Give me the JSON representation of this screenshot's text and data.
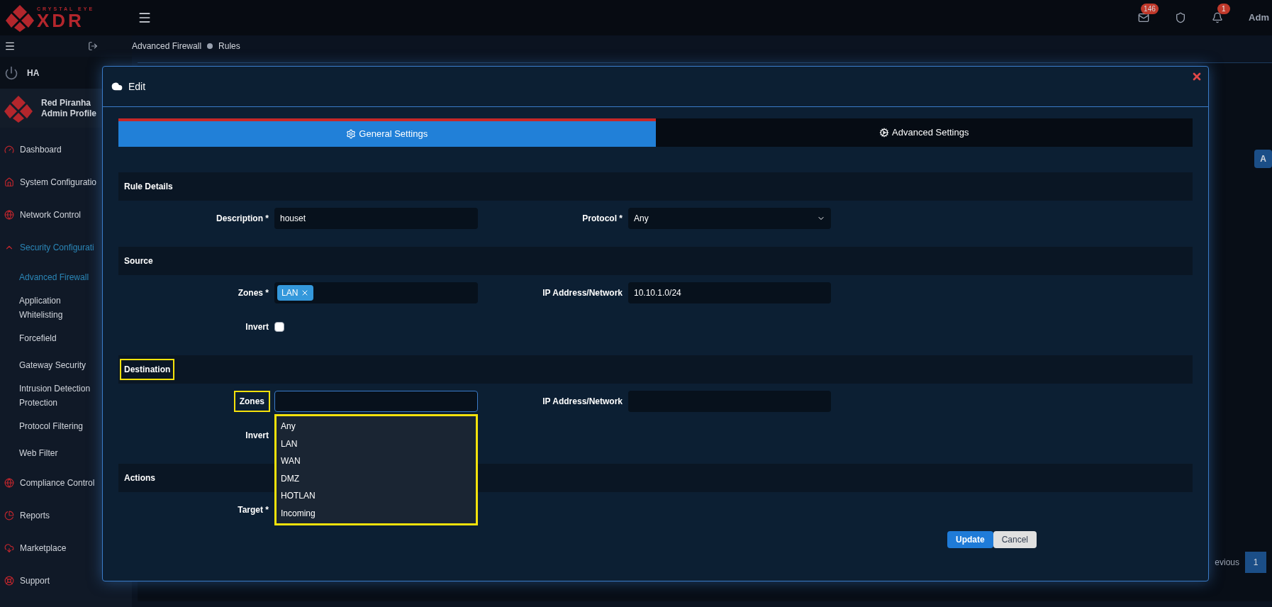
{
  "topbar": {
    "brand": "CRYSTAL EYE",
    "logo_mark": "XDR",
    "mail_badge": "146",
    "alert_badge": "1",
    "user": "Adm"
  },
  "breadcrumb": [
    "Advanced Firewall",
    "Rules"
  ],
  "sidebar": {
    "status": "HA",
    "profile": {
      "name": "Red Piranha",
      "role": "Admin Profile"
    },
    "items": [
      {
        "label": "Dashboard",
        "selected": false
      },
      {
        "label": "System Configuratio",
        "selected": false
      },
      {
        "label": "Network Control",
        "selected": false
      },
      {
        "label": "Security Configurati",
        "selected": true,
        "children": [
          {
            "label": "Advanced Firewall",
            "selected": true
          },
          {
            "label": "Application Whitelisting",
            "selected": false
          },
          {
            "label": "Forcefield",
            "selected": false
          },
          {
            "label": "Gateway Security",
            "selected": false
          },
          {
            "label": "Intrusion Detection Protection",
            "selected": false
          },
          {
            "label": "Protocol Filtering",
            "selected": false
          },
          {
            "label": "Web Filter",
            "selected": false
          }
        ]
      },
      {
        "label": "Compliance Control",
        "selected": false
      },
      {
        "label": "Reports",
        "selected": false
      },
      {
        "label": "Marketplace",
        "selected": false
      },
      {
        "label": "Support",
        "selected": false
      }
    ]
  },
  "background": {
    "add_button": "A",
    "pagination_previous": "evious",
    "page": "1"
  },
  "modal": {
    "title": "Edit",
    "tabs": [
      {
        "label": "General Settings",
        "selected": true
      },
      {
        "label": "Advanced Settings",
        "selected": false
      }
    ],
    "sections": [
      {
        "title": "Rule Details",
        "highlighted": false,
        "rows": [
          [
            {
              "kind": "text",
              "label": "Description *",
              "value": "houset"
            },
            {
              "kind": "select",
              "label": "Protocol *",
              "value": "Any"
            }
          ]
        ]
      },
      {
        "title": "Source",
        "highlighted": false,
        "rows": [
          [
            {
              "kind": "tags",
              "label": "Zones *",
              "tags": [
                "LAN"
              ]
            },
            {
              "kind": "text",
              "label": "IP Address/Network",
              "value": "10.10.1.0/24"
            }
          ],
          [
            {
              "kind": "checkbox",
              "label": "Invert",
              "checked": false
            }
          ]
        ]
      },
      {
        "title": "Destination",
        "highlighted": true,
        "rows": [
          [
            {
              "kind": "combo",
              "label": "Zones",
              "label_highlighted": true
            },
            {
              "kind": "text",
              "label": "IP Address/Network"
            }
          ],
          [
            {
              "kind": "label",
              "label": "Invert"
            }
          ]
        ],
        "dropdown": {
          "highlighted": true,
          "options": [
            "Any",
            "LAN",
            "WAN",
            "DMZ",
            "HOTLAN",
            "Incoming"
          ]
        }
      },
      {
        "title": "Actions",
        "highlighted": false,
        "rows": [
          [
            {
              "kind": "label",
              "label": "Target *"
            }
          ]
        ]
      }
    ],
    "buttons": [
      {
        "label": "Update",
        "primary": true
      },
      {
        "label": "Cancel",
        "primary": false
      }
    ]
  }
}
